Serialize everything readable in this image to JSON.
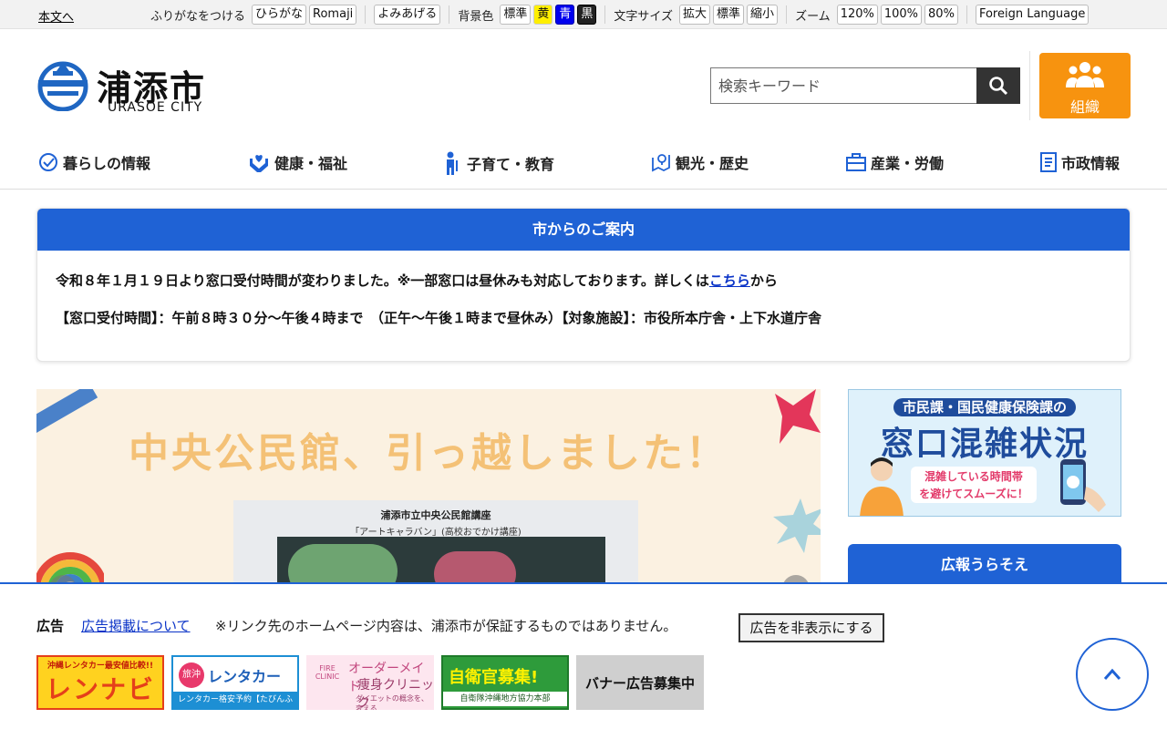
{
  "util": {
    "skip": "本文へ",
    "furigana_label": "ふりがなをつける",
    "furigana_buttons": [
      "ひらがな",
      "Romaji"
    ],
    "readaloud": "よみあげる",
    "bg_label": "背景色",
    "bg_buttons": [
      "標準",
      "黄",
      "青",
      "黒"
    ],
    "size_label": "文字サイズ",
    "size_buttons": [
      "拡大",
      "標準",
      "縮小"
    ],
    "zoom_label": "ズーム",
    "zoom_buttons": [
      "120%",
      "100%",
      "80%"
    ],
    "foreign": "Foreign Language"
  },
  "header": {
    "logo_name": "浦添市",
    "logo_sub": "URASOE CITY",
    "search_placeholder": "検索キーワード",
    "org_label": "組織"
  },
  "nav": [
    {
      "label": "暮らしの情報",
      "icon": "life-icon"
    },
    {
      "label": "健康・福祉",
      "icon": "heart-hands-icon"
    },
    {
      "label": "子育て・教育",
      "icon": "child-icon"
    },
    {
      "label": "観光・歴史",
      "icon": "map-pin-icon"
    },
    {
      "label": "産業・労働",
      "icon": "briefcase-icon"
    },
    {
      "label": "市政情報",
      "icon": "document-icon"
    }
  ],
  "notice": {
    "title": "市からのご案内",
    "line1_before": "令和８年１月１９日より窓口受付時間が変わりました。※一部窓口は昼休みも対応しております。詳しくは",
    "line1_link": "こちら",
    "line1_after": "から",
    "line2": "【窓口受付時間】：午前８時３０分〜午後４時まで　（正午〜午後１時まで昼休み）【対象施設】：市役所本庁舎・上下水道庁舎"
  },
  "hero": {
    "title": "中央公民館、引っ越しました！",
    "caption1": "浦添市立中央公民館講座",
    "caption2": "「アートキャラバン」(高校おでかけ講座)"
  },
  "side": {
    "madoguchi_top": "市民課・国民健康保険課の",
    "madoguchi_main": "窓口混雑状況",
    "madoguchi_sub1": "混雑している時間帯",
    "madoguchi_sub2": "を避けてスムーズに！",
    "kouhou": "広報うらそえ"
  },
  "ads": {
    "label": "広告",
    "link": "広告掲載について",
    "note": "※リンク先のホームページ内容は、浦添市が保証するものではありません。",
    "hide": "広告を非表示にする",
    "b1_top": "沖縄レンタカー最安値比較!!",
    "b1_main": "レンナビ",
    "b2_circle": "旅沖縄",
    "b2_main": "レンタカー",
    "b2_sub": "レンタカー格安予約【たびんふぉ】",
    "b3_fire": "FIRE CLINIC",
    "b3_l1": "オーダーメイド",
    "b3_l2": "痩身クリニック",
    "b3_l3": "ダイエットの概念を、変える",
    "b4_main": "自衛官募集!",
    "b4_sub": "自衛隊沖縄地方協力本部",
    "b5_main": "バナー広告募集中"
  },
  "colors": {
    "primary": "#1f62d5",
    "org": "#f7930f"
  }
}
